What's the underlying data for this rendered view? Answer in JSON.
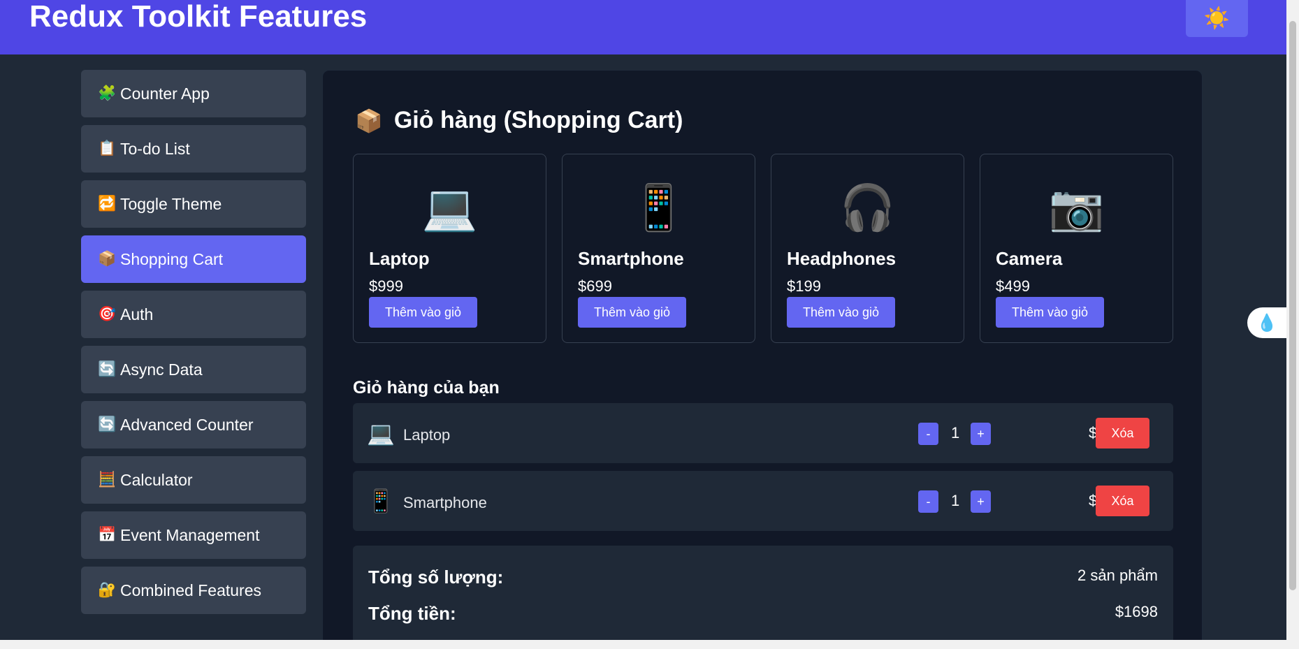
{
  "header": {
    "title": "Redux Toolkit Features",
    "theme_icon": "☀️"
  },
  "sidebar": {
    "items": [
      {
        "icon": "🧩",
        "label": "Counter App"
      },
      {
        "icon": "📋",
        "label": "To-do List"
      },
      {
        "icon": "🔁",
        "label": "Toggle Theme"
      },
      {
        "icon": "📦",
        "label": "Shopping Cart"
      },
      {
        "icon": "🎯",
        "label": "Auth"
      },
      {
        "icon": "🔄",
        "label": "Async Data"
      },
      {
        "icon": "🔄",
        "label": "Advanced Counter"
      },
      {
        "icon": "🧮",
        "label": "Calculator"
      },
      {
        "icon": "📅",
        "label": "Event Management"
      },
      {
        "icon": "🔐",
        "label": "Combined Features"
      }
    ],
    "active": "Shopping Cart"
  },
  "main": {
    "title_icon": "📦",
    "title": "Giỏ hàng (Shopping Cart)",
    "products": [
      {
        "icon": "💻",
        "name": "Laptop",
        "price": "$999",
        "button": "Thêm vào giỏ"
      },
      {
        "icon": "📱",
        "name": "Smartphone",
        "price": "$699",
        "button": "Thêm vào giỏ"
      },
      {
        "icon": "🎧",
        "name": "Headphones",
        "price": "$199",
        "button": "Thêm vào giỏ"
      },
      {
        "icon": "📷",
        "name": "Camera",
        "price": "$499",
        "button": "Thêm vào giỏ"
      }
    ],
    "cart_heading": "Giỏ hàng của bạn",
    "cart": [
      {
        "icon": "💻",
        "name": "Laptop",
        "minus": "-",
        "qty": "1",
        "plus": "+",
        "price": "$999",
        "delete": "Xóa"
      },
      {
        "icon": "📱",
        "name": "Smartphone",
        "minus": "-",
        "qty": "1",
        "plus": "+",
        "price": "$699",
        "delete": "Xóa"
      }
    ],
    "summary": {
      "qty_label": "Tổng số lượng:",
      "qty_value": "2 sản phẩm",
      "total_label": "Tổng tiền:",
      "total_value": "$1698"
    }
  },
  "float_button_icon": "💧",
  "colors": {
    "header": "#4f46e5",
    "accent": "#6366f1",
    "danger": "#ef4444",
    "panel": "#111827",
    "bg": "#1f2937"
  }
}
